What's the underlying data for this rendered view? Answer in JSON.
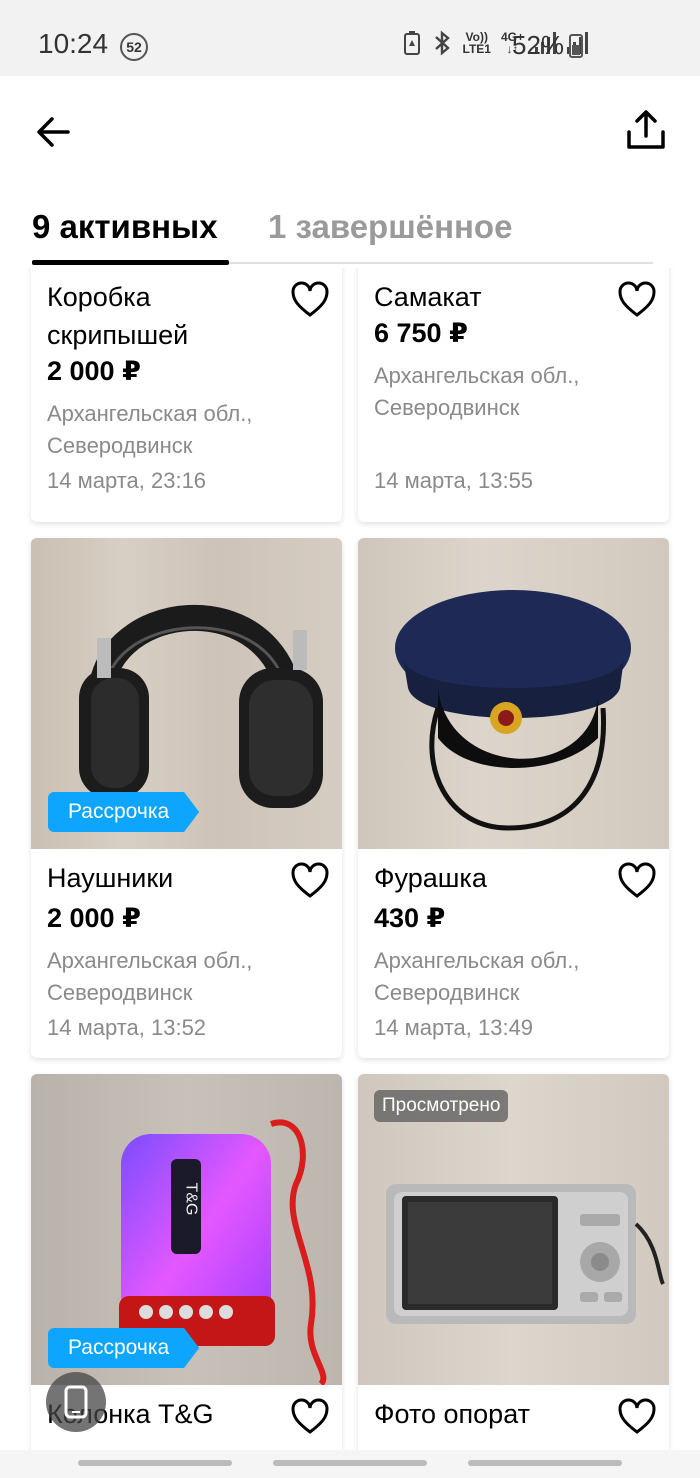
{
  "status_bar": {
    "time": "10:24",
    "notification_count": "52",
    "network_label_top": "Vo))",
    "network_label_bottom": "LTE1",
    "network_gen": "4G+",
    "battery": "52%"
  },
  "header": {
    "back_icon": "arrow-left-icon",
    "share_icon": "share-upload-icon"
  },
  "tabs": [
    {
      "label": "9 активных",
      "active": true
    },
    {
      "label": "1 завершённое",
      "active": false
    }
  ],
  "listings": [
    {
      "title": "Коробка скрипышей",
      "price": "2 000 ₽",
      "location": "Архангельская обл., Северодвинск",
      "date": "14 марта, 23:16"
    },
    {
      "title": "Самакат",
      "price": "6 750 ₽",
      "location": "Архангельская обл., Северодвинск",
      "date": "14 марта, 13:55"
    },
    {
      "title": "Наушники",
      "price": "2 000 ₽",
      "location": "Архангельская обл., Северодвинск",
      "date": "14 марта, 13:52",
      "badge": "Рассрочка"
    },
    {
      "title": "Фурашка",
      "price": "430 ₽",
      "location": "Архангельская обл., Северодвинск",
      "date": "14 марта, 13:49"
    },
    {
      "title": "Колонка T&G",
      "price": "",
      "badge": "Рассрочка",
      "image_text": "T&G"
    },
    {
      "title": "Фото опорат",
      "price": "",
      "viewed": "Просмотрено"
    }
  ],
  "colors": {
    "accent_blue": "#0ea5ff",
    "text_secondary": "#8a8a8a",
    "tab_inactive": "#9a9a9a"
  }
}
